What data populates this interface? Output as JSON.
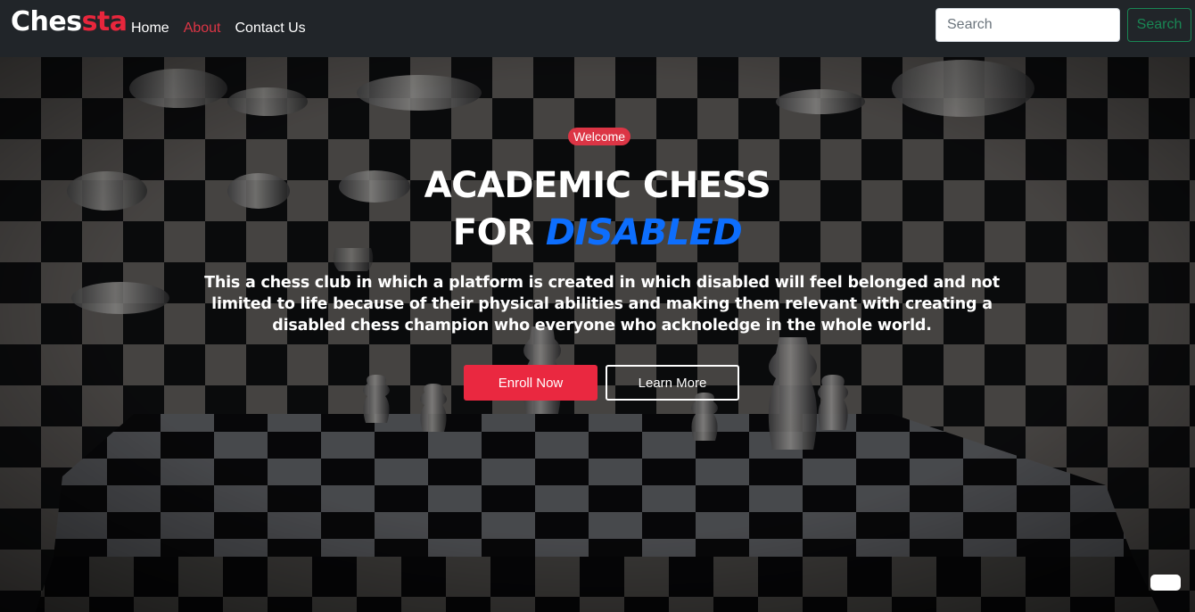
{
  "brand": {
    "part1": "Ches",
    "part2": "sta"
  },
  "nav": {
    "items": [
      {
        "label": "Home",
        "active": false
      },
      {
        "label": "About",
        "active": true
      },
      {
        "label": "Contact Us",
        "active": false
      }
    ]
  },
  "search": {
    "placeholder": "Search",
    "value": "",
    "button_label": "Search"
  },
  "hero": {
    "badge": "Welcome",
    "title_line1": "ACADEMIC CHESS",
    "title_line2_prefix": "FOR ",
    "title_line2_accent": "DISABLED",
    "description": "This a chess club in which a platform is created in which disabled will feel belonged and not limited to life because of their physical abilities and making them relevant with creating a disabled chess champion who everyone who acknoledge in the whole world.",
    "primary_button": "Enroll Now",
    "secondary_button": "Learn More"
  },
  "colors": {
    "navbar_bg": "#212529",
    "brand_accent": "#e8263c",
    "active_link": "#dc3545",
    "title_accent": "#0d6efd",
    "enroll_button": "#ea2840",
    "search_button": "#198754"
  },
  "icons": {
    "background": "chessboard-pieces-image",
    "widget": "floating-widget"
  }
}
